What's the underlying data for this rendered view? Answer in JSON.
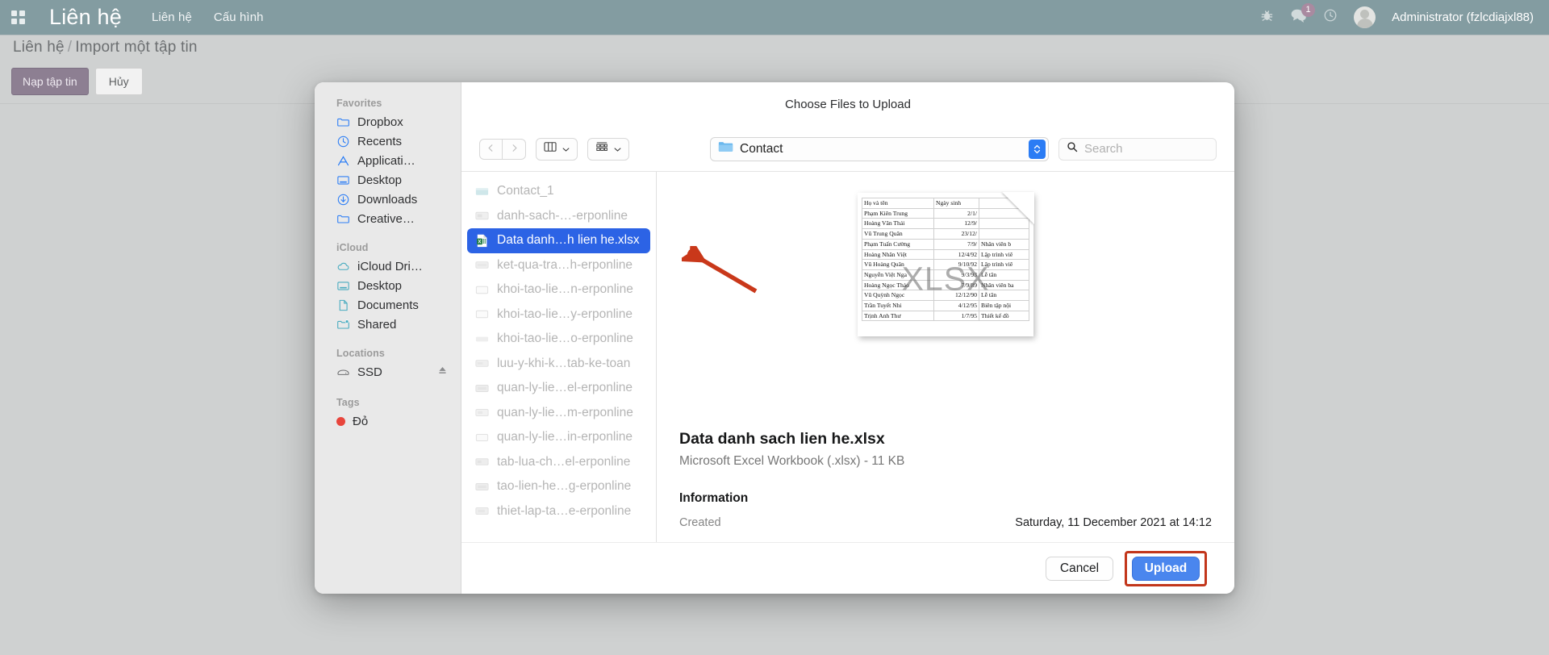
{
  "app": {
    "menu_icon": "grid-apps-icon",
    "title": "Liên hệ",
    "nav": [
      {
        "label": "Liên hệ"
      },
      {
        "label": "Cấu hình"
      }
    ],
    "header_right": {
      "bug_icon": "bug-icon",
      "messages_icon": "chat-bubble-icon",
      "messages_badge": "1",
      "clock_icon": "clock-icon",
      "avatar": "user-avatar",
      "user_label": "Administrator (fzlcdiajxl88)"
    }
  },
  "breadcrumb": {
    "root": "Liên hệ",
    "separator": "/",
    "current": "Import một tập tin"
  },
  "actions": {
    "primary_label": "Nạp tập tin",
    "secondary_label": "Hủy"
  },
  "dialog": {
    "title": "Choose Files to Upload",
    "toolbar": {
      "back_icon": "chevron-left-icon",
      "forward_icon": "chevron-right-icon",
      "view_icon": "column-view-icon",
      "view_chevron": "chevron-down-icon",
      "group_icon": "group-by-icon",
      "group_chevron": "chevron-down-icon",
      "path_folder_icon": "folder-icon",
      "path_label": "Contact",
      "stepper_icon": "up-down-stepper-icon",
      "search_icon": "search-icon",
      "search_value": "",
      "search_placeholder": "Search"
    },
    "sidebar": {
      "sections": [
        {
          "title": "Favorites",
          "items": [
            {
              "label": "Dropbox",
              "icon": "folder-icon",
              "color": "#2f7ff5"
            },
            {
              "label": "Recents",
              "icon": "clock-icon",
              "color": "#2f7ff5"
            },
            {
              "label": "Applicati…",
              "icon": "applications-icon",
              "color": "#2f7ff5"
            },
            {
              "label": "Desktop",
              "icon": "desktop-icon",
              "color": "#2f7ff5"
            },
            {
              "label": "Downloads",
              "icon": "download-icon",
              "color": "#2f7ff5"
            },
            {
              "label": "Creative…",
              "icon": "folder-icon",
              "color": "#2f7ff5"
            }
          ]
        },
        {
          "title": "iCloud",
          "items": [
            {
              "label": "iCloud Dri…",
              "icon": "cloud-icon",
              "color": "#4aacc0"
            },
            {
              "label": "Desktop",
              "icon": "desktop-icon",
              "color": "#4aacc0"
            },
            {
              "label": "Documents",
              "icon": "document-icon",
              "color": "#4aacc0"
            },
            {
              "label": "Shared",
              "icon": "shared-folder-icon",
              "color": "#4aacc0"
            }
          ]
        },
        {
          "title": "Locations",
          "items": [
            {
              "label": "SSD",
              "icon": "drive-icon",
              "color": "#6d6e70",
              "eject": "eject-icon"
            }
          ]
        },
        {
          "title": "Tags",
          "items": [
            {
              "label": "Đỏ",
              "icon": "tag-dot-icon",
              "color": "#e8453c"
            }
          ]
        }
      ]
    },
    "files": [
      {
        "name": "Contact_1",
        "icon": "file-icon",
        "selected": false
      },
      {
        "name": "danh-sach-…-erponline",
        "icon": "file-icon",
        "selected": false
      },
      {
        "name": "Data danh…h lien he.xlsx",
        "icon": "excel-icon",
        "selected": true
      },
      {
        "name": "ket-qua-tra…h-erponline",
        "icon": "file-icon",
        "selected": false
      },
      {
        "name": "khoi-tao-lie…n-erponline",
        "icon": "file-icon",
        "selected": false
      },
      {
        "name": "khoi-tao-lie…y-erponline",
        "icon": "file-icon",
        "selected": false
      },
      {
        "name": "khoi-tao-lie…o-erponline",
        "icon": "file-icon",
        "selected": false
      },
      {
        "name": "luu-y-khi-k…tab-ke-toan",
        "icon": "file-icon",
        "selected": false
      },
      {
        "name": "quan-ly-lie…el-erponline",
        "icon": "file-icon",
        "selected": false
      },
      {
        "name": "quan-ly-lie…m-erponline",
        "icon": "file-icon",
        "selected": false
      },
      {
        "name": "quan-ly-lie…in-erponline",
        "icon": "file-icon",
        "selected": false
      },
      {
        "name": "tab-lua-ch…el-erponline",
        "icon": "file-icon",
        "selected": false
      },
      {
        "name": "tao-lien-he…g-erponline",
        "icon": "file-icon",
        "selected": false
      },
      {
        "name": "thiet-lap-ta…e-erponline",
        "icon": "file-icon",
        "selected": false
      }
    ],
    "preview": {
      "watermark": "XLSX",
      "sheet_headers": [
        "Họ và tên",
        "Ngày sinh",
        ""
      ],
      "sheet_rows": [
        [
          "Phạm Kiên Trung",
          "2/1/",
          ""
        ],
        [
          "Hoàng Văn Thái",
          "12/9/",
          ""
        ],
        [
          "Vũ Trung Quân",
          "23/12/",
          ""
        ],
        [
          "Phạm Tuấn Cường",
          "7/9/",
          "Nhân viên b"
        ],
        [
          "Hoàng Nhân Việt",
          "12/4/92",
          "Lập trình viê"
        ],
        [
          "Vũ Hoàng Quân",
          "9/10/92",
          "Lập trình viê"
        ],
        [
          "Nguyễn Việt Nga",
          "9/3/93",
          "Lễ tân"
        ],
        [
          "Hoàng Ngọc Thảo",
          "7/9/89",
          "Nhân viên ba"
        ],
        [
          "Vũ Quỳnh Ngọc",
          "12/12/90",
          "Lễ tân"
        ],
        [
          "Trần Tuyết Nhi",
          "4/12/95",
          "Biên tập nội"
        ],
        [
          "Trịnh Anh Thư",
          "1/7/95",
          "Thiết kế đồ"
        ]
      ],
      "file_name": "Data danh sach lien he.xlsx",
      "file_kind": "Microsoft Excel Workbook (.xlsx) - 11 KB",
      "info_heading": "Information",
      "created_label": "Created",
      "created_value": "Saturday, 11 December 2021 at 14:12"
    },
    "footer": {
      "cancel_label": "Cancel",
      "upload_label": "Upload",
      "highlight_color": "#c2361b"
    }
  },
  "annotation": {
    "arrow_color": "#c9381a",
    "arrow_target": "selected-file-row"
  }
}
